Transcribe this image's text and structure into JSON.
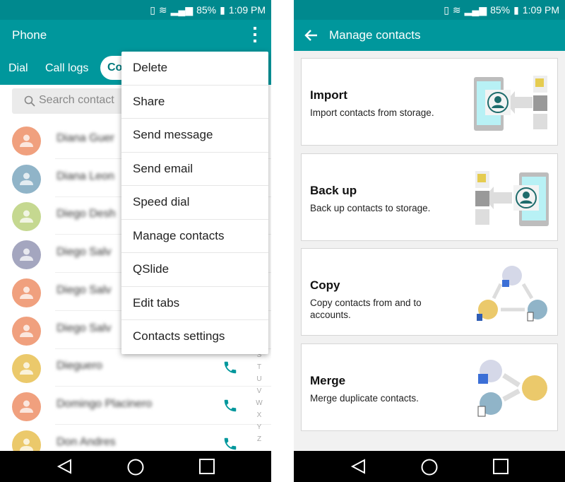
{
  "status_bar": {
    "battery": "85%",
    "time": "1:09 PM"
  },
  "left": {
    "app_title": "Phone",
    "tabs": [
      {
        "label": "Dial"
      },
      {
        "label": "Call logs"
      },
      {
        "label": "Co"
      }
    ],
    "search_placeholder": "Search contact",
    "contacts": [
      {
        "name": "Diana Guer",
        "color": "#f0a07e"
      },
      {
        "name": "Diana Leon",
        "color": "#90b4c8"
      },
      {
        "name": "Diego Desh",
        "color": "#c5d890"
      },
      {
        "name": "Diego Salv",
        "color": "#a4a6bf"
      },
      {
        "name": "Diego Salv",
        "color": "#f0a07e"
      },
      {
        "name": "Diego Salv",
        "color": "#f0a07e"
      },
      {
        "name": "Dieguero",
        "color": "#ebc96b"
      },
      {
        "name": "Domingo Placinero",
        "color": "#f0a07e"
      },
      {
        "name": "Don Andres",
        "color": "#ebc96b"
      }
    ],
    "index_letters": [
      "S",
      "T",
      "U",
      "V",
      "W",
      "X",
      "Y",
      "Z"
    ],
    "menu": [
      "Delete",
      "Share",
      "Send message",
      "Send email",
      "Speed dial",
      "Manage contacts",
      "QSlide",
      "Edit tabs",
      "Contacts settings"
    ]
  },
  "right": {
    "title": "Manage contacts",
    "cards": [
      {
        "title": "Import",
        "desc": "Import contacts from storage."
      },
      {
        "title": "Back up",
        "desc": "Back up contacts to storage."
      },
      {
        "title": "Copy",
        "desc": "Copy contacts from and to accounts."
      },
      {
        "title": "Merge",
        "desc": "Merge duplicate contacts."
      }
    ]
  },
  "colors": {
    "accent": "#00979c",
    "status": "#00898e",
    "call_icon": "#00979c"
  }
}
